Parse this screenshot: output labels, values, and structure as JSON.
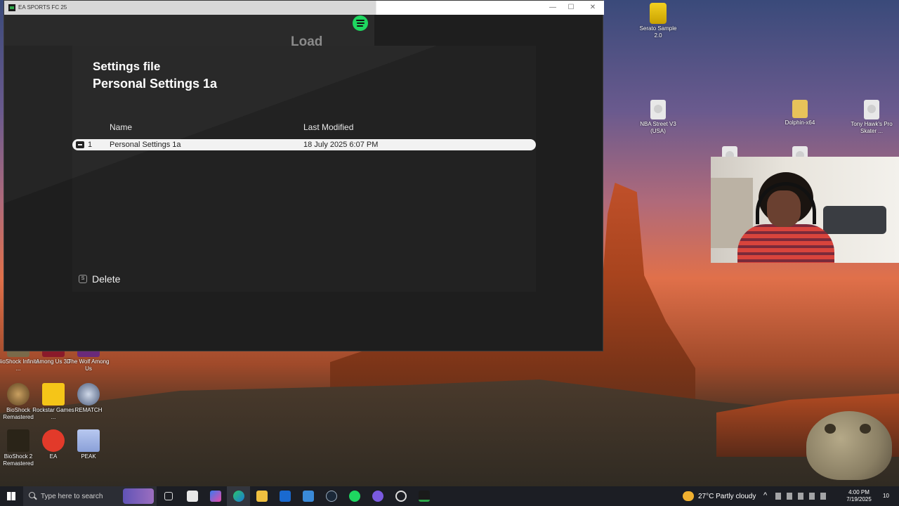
{
  "window": {
    "title": "EA SPORTS FC 25",
    "controls": {
      "minimize": "—",
      "maximize": "☐",
      "close": "✕"
    }
  },
  "screen": {
    "title": "Load",
    "settings_label": "Settings file",
    "settings_name": "Personal Settings 1a",
    "columns": {
      "name": "Name",
      "modified": "Last Modified"
    },
    "rows": [
      {
        "index": "1",
        "name": "Personal Settings 1a",
        "modified": "18 July 2025 6:07 PM"
      }
    ],
    "delete": {
      "key": "S",
      "label": "Delete"
    }
  },
  "desktop": {
    "icons_right": [
      {
        "label": "Serato Sample 2.0",
        "icon": "serato-icon"
      },
      {
        "label": "NBA Street V3 (USA)",
        "icon": "file-icon"
      },
      {
        "label": "Dolphin-x64",
        "icon": "folder-icon"
      },
      {
        "label": "Tony Hawk's Pro Skater ...",
        "icon": "file-icon"
      }
    ],
    "icons_left": [
      {
        "label": "BioShock Infinite ...",
        "icon": "bioshock-infinite-icon"
      },
      {
        "label": "Among Us 3D",
        "icon": "among-us-icon"
      },
      {
        "label": "The Wolf Among Us",
        "icon": "wolf-among-us-icon"
      },
      {
        "label": "BioShock Remastered",
        "icon": "bioshock-icon"
      },
      {
        "label": "Rockstar Games ...",
        "icon": "rockstar-icon"
      },
      {
        "label": "REMATCH",
        "icon": "rematch-icon"
      },
      {
        "label": "BioShock 2 Remastered",
        "icon": "bioshock2-icon"
      },
      {
        "label": "EA",
        "icon": "ea-icon"
      },
      {
        "label": "PEAK",
        "icon": "peak-icon"
      }
    ]
  },
  "taskbar": {
    "search_placeholder": "Type here to search",
    "weather": "27°C  Partly cloudy",
    "time": "4:00 PM",
    "date": "7/19/2025",
    "notifications": "10"
  },
  "colors": {
    "spotify": "#1ed760",
    "ea_red": "#e23a2a",
    "rockstar_yellow": "#f5c518"
  }
}
